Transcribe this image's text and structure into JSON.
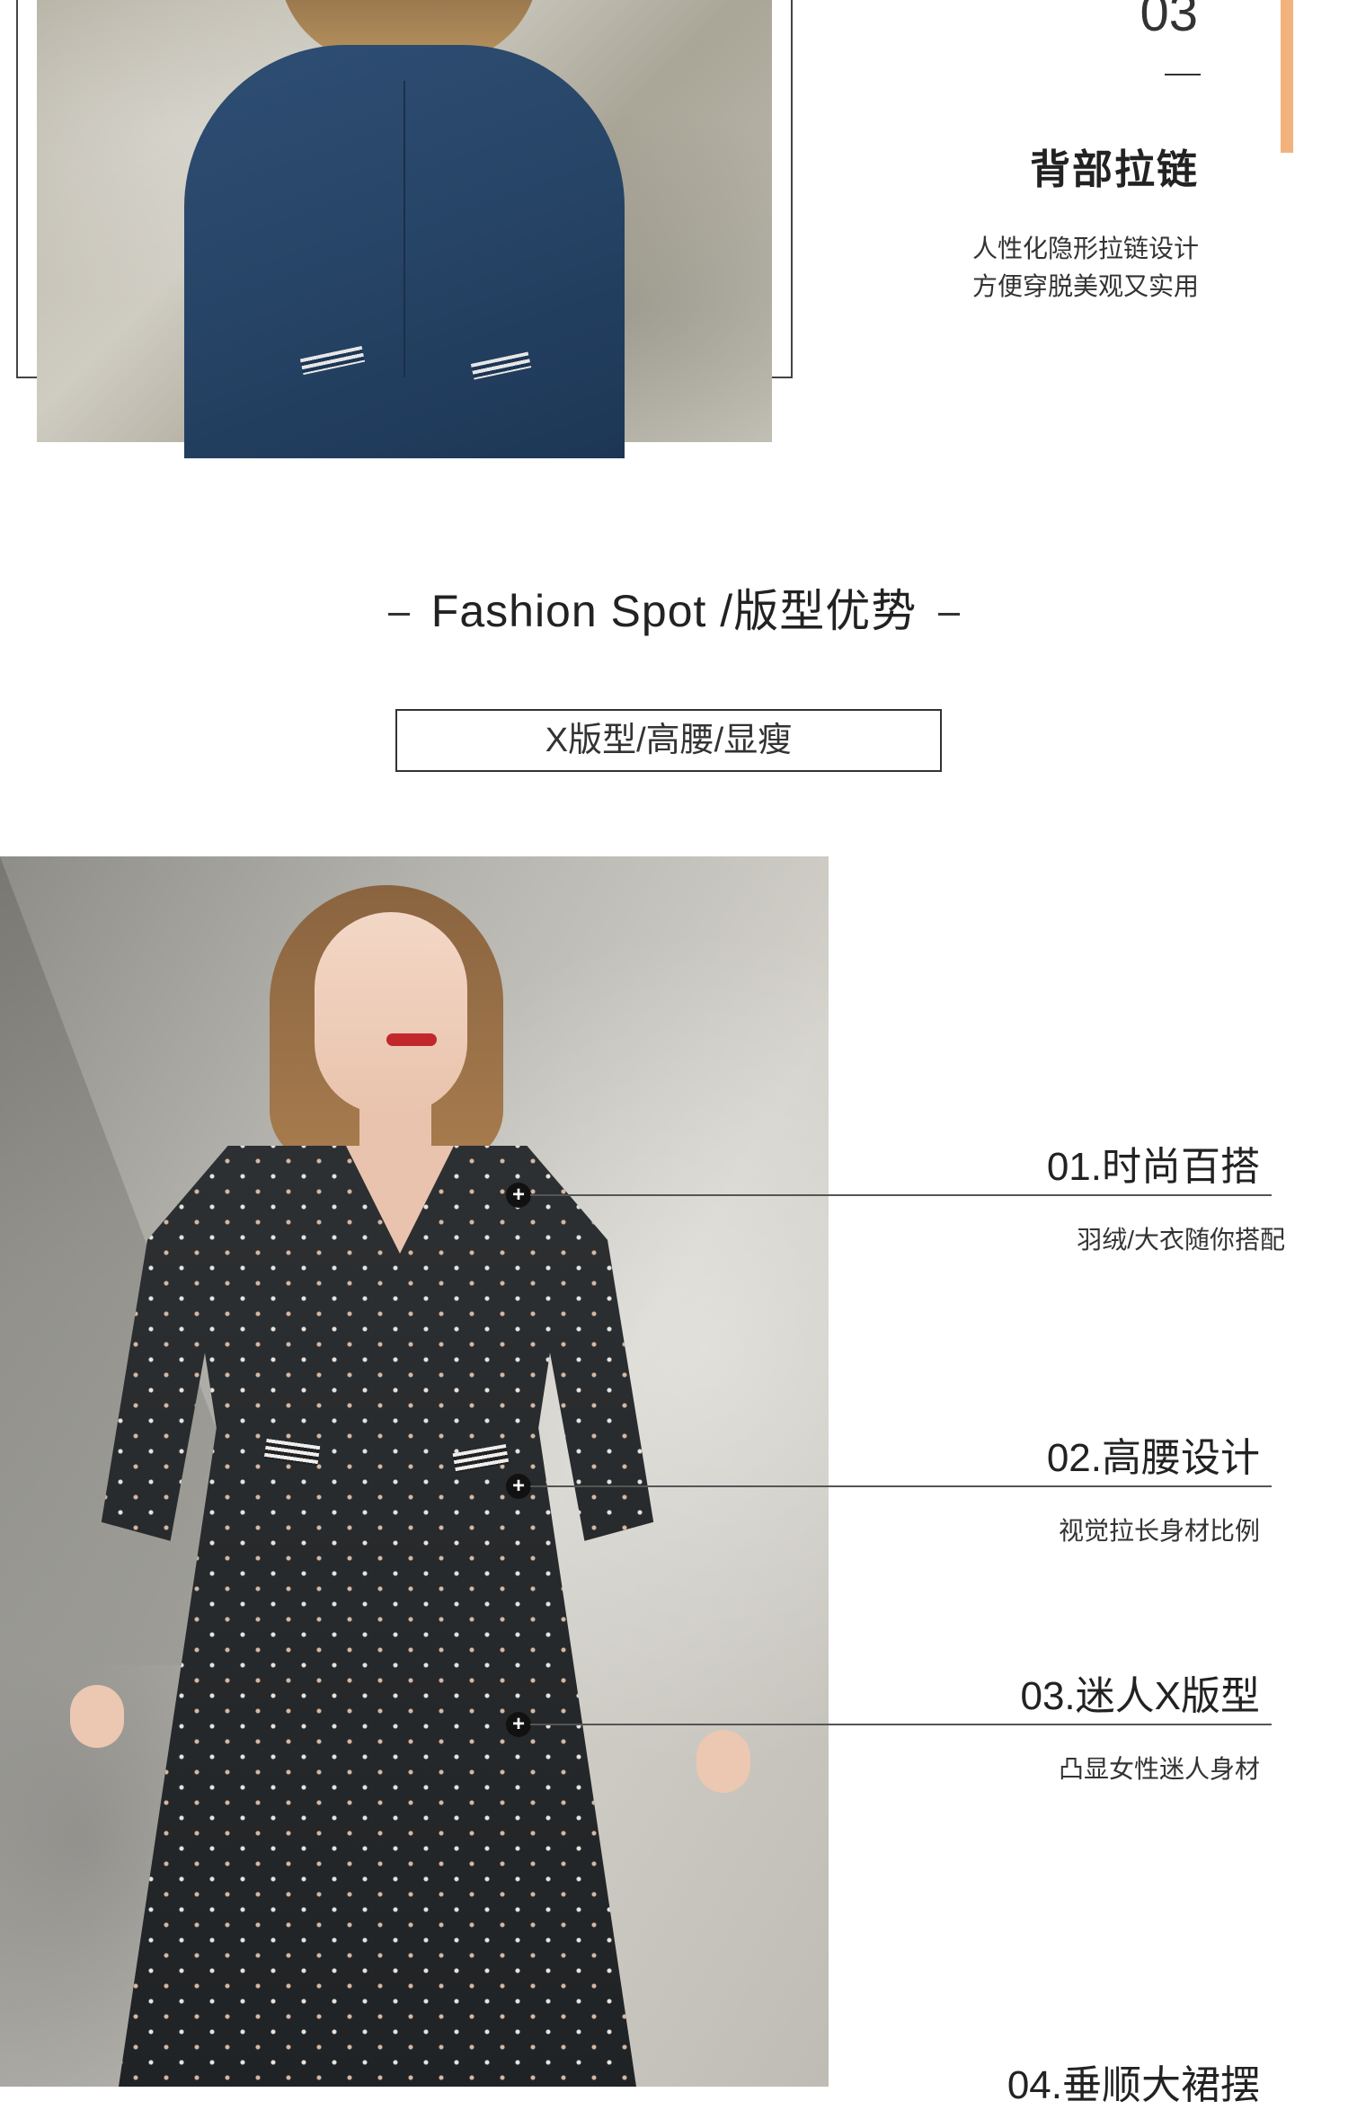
{
  "zipper_section": {
    "number": "03",
    "title": "背部拉链",
    "desc_line1": "人性化隐形拉链设计",
    "desc_line2": "方便穿脱美观又实用"
  },
  "fashion_spot": {
    "heading": "Fashion Spot /版型优势",
    "tag": "X版型/高腰/显瘦"
  },
  "features": [
    {
      "title": "01.时尚百搭",
      "subtitle": "羽绒/大衣随你搭配"
    },
    {
      "title": "02.高腰设计",
      "subtitle": "视觉拉长身材比例"
    },
    {
      "title": "03.迷人X版型",
      "subtitle": "凸显女性迷人身材"
    },
    {
      "title": "04.垂顺大裙摆"
    }
  ],
  "marker_symbol": "+",
  "colors": {
    "accent_bar": "#f2b27d",
    "dress": "#2d3032",
    "coat": "#2f4e74"
  }
}
